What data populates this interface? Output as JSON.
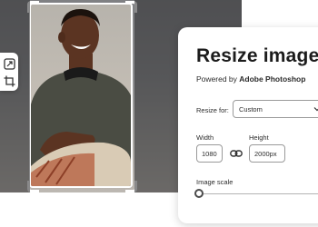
{
  "panel": {
    "title": "Resize image",
    "powered_prefix": "Powered by ",
    "powered_brand": "Adobe Photoshop",
    "resize_for_label": "Resize for:",
    "resize_for_value": "Custom",
    "width_label": "Width",
    "width_value": "1080",
    "height_label": "Height",
    "height_value": "2000px",
    "scale_label": "Image scale",
    "scale_level": 0
  },
  "tools": [
    "crop-aspect-icon",
    "crop-icon"
  ],
  "colors": {
    "panel_bg": "#ffffff",
    "text": "#1c1c1c",
    "border": "#9a9a9a",
    "shirt": "#4a4c43",
    "collar": "#1a1a1a",
    "skin": "#5b3422"
  }
}
